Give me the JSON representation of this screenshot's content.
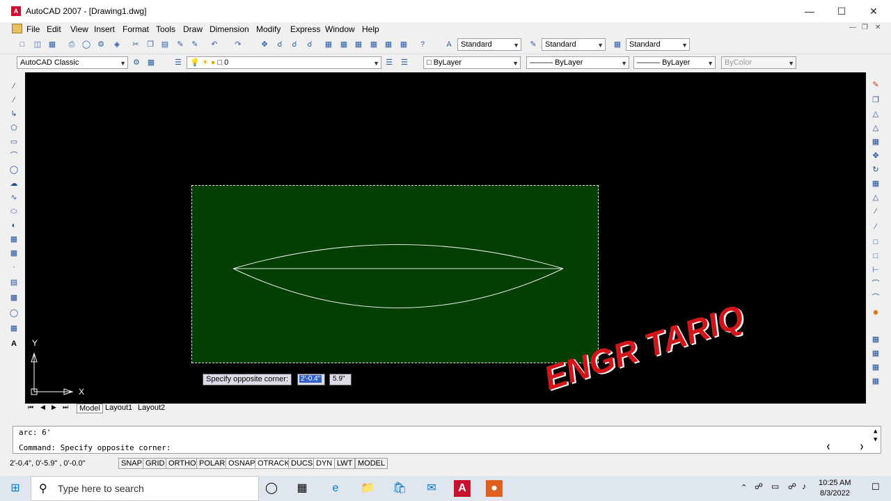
{
  "window": {
    "title": "AutoCAD 2007 - [Drawing1.dwg]"
  },
  "menu": [
    "File",
    "Edit",
    "View",
    "Insert",
    "Format",
    "Tools",
    "Draw",
    "Dimension",
    "Modify",
    "Express",
    "Window",
    "Help"
  ],
  "toolbar": {
    "text_style": "Standard",
    "dim_style": "Standard",
    "table_style": "Standard",
    "workspace": "AutoCAD Classic",
    "layer": "0",
    "color": "ByLayer",
    "linetype": "ByLayer",
    "lineweight": "ByLayer",
    "plotstyle": "ByColor"
  },
  "tooltip": {
    "label": "Specify opposite corner:",
    "value1": "2'-0.4\"",
    "value2": "5.9\""
  },
  "ucs": {
    "x": "X",
    "y": "Y"
  },
  "tabs": [
    "Model",
    "Layout1",
    "Layout2"
  ],
  "command": {
    "line1": "arc: 6'",
    "line2": "Command: Specify opposite corner:"
  },
  "status": {
    "coords": "2'-0.4\", 0'-5.9\" , 0'-0.0\"",
    "buttons": [
      "SNAP",
      "GRID",
      "ORTHO",
      "POLAR",
      "OSNAP",
      "OTRACK",
      "DUCS",
      "DYN",
      "LWT",
      "MODEL"
    ]
  },
  "taskbar": {
    "search_placeholder": "Type here to search",
    "time": "10:25 AM",
    "date": "8/3/2022"
  },
  "watermark": {
    "text": "ENGR TARIQ",
    "color": "#d1151a"
  },
  "colors": {
    "selection_fill": "#003f00",
    "canvas": "#000000"
  }
}
